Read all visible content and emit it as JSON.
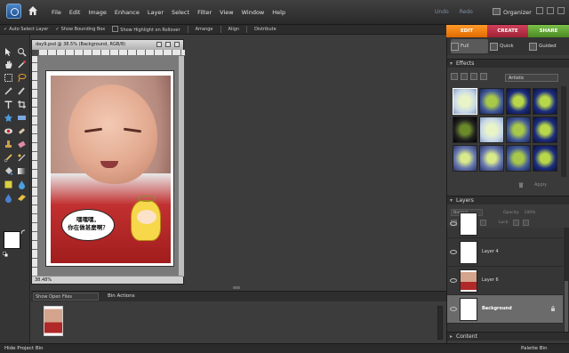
{
  "menu": {
    "items": [
      "File",
      "Edit",
      "Image",
      "Enhance",
      "Layer",
      "Select",
      "Filter",
      "View",
      "Window",
      "Help"
    ],
    "undo": "Undo",
    "redo": "Redo",
    "organizer": "Organizer"
  },
  "options_bar": {
    "auto_select": "Auto Select Layer",
    "bounding_box": "Show Bounding Box",
    "highlight": "Show Highlight on Rollover",
    "arrange": "Arrange",
    "align": "Align",
    "distribute": "Distribute"
  },
  "mode_tabs": {
    "edit": "EDIT",
    "create": "CREATE",
    "share": "SHARE"
  },
  "edit_modes": {
    "full": "Full",
    "quick": "Quick",
    "guided": "Guided"
  },
  "document": {
    "title": "day9.psd @ 38.5% (Background, RGB/8)",
    "zoom": "38.48%",
    "bubble_text_line1": "嘿嘿嘿，",
    "bubble_text_line2": "你在做甚麼啊？"
  },
  "effects": {
    "header": "Effects",
    "category": "Artistic",
    "apply": "Apply"
  },
  "layers": {
    "header": "Layers",
    "blend_mode": "Normal",
    "opacity_label": "Opacity:",
    "opacity_value": "100%",
    "lock_label": "Lock:",
    "items": [
      {
        "name": ""
      },
      {
        "name": "Layer 4"
      },
      {
        "name": "Layer 6"
      },
      {
        "name": "Background"
      }
    ]
  },
  "content": {
    "header": "Content"
  },
  "project_bin": {
    "show": "Show Open Files",
    "actions": "Bin Actions"
  },
  "bottom": {
    "hide_bin": "Hide Project Bin",
    "palette_bin": "Palette Bin"
  }
}
